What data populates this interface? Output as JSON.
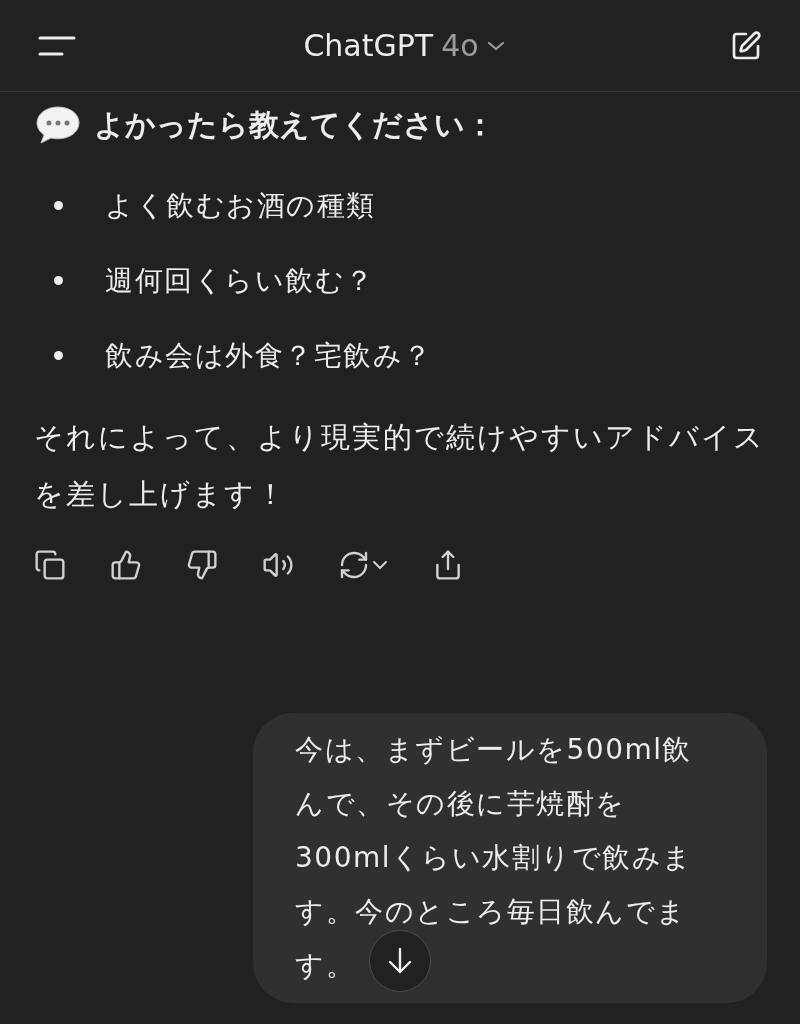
{
  "header": {
    "title": "ChatGPT",
    "model": "4o"
  },
  "reply": {
    "heading": "よかったら教えてください：",
    "bullets": [
      "よく飲むお酒の種類",
      "週何回くらい飲む？",
      "飲み会は外食？宅飲み？"
    ],
    "paragraph": "それによって、より現実的で続けやすいアドバイスを差し上げます！"
  },
  "user_message": {
    "text": "今は、まずビールを500ml飲んで、その後に芋焼酎を300mlくらい水割りで飲みます。今のところ毎日飲んでます。"
  }
}
